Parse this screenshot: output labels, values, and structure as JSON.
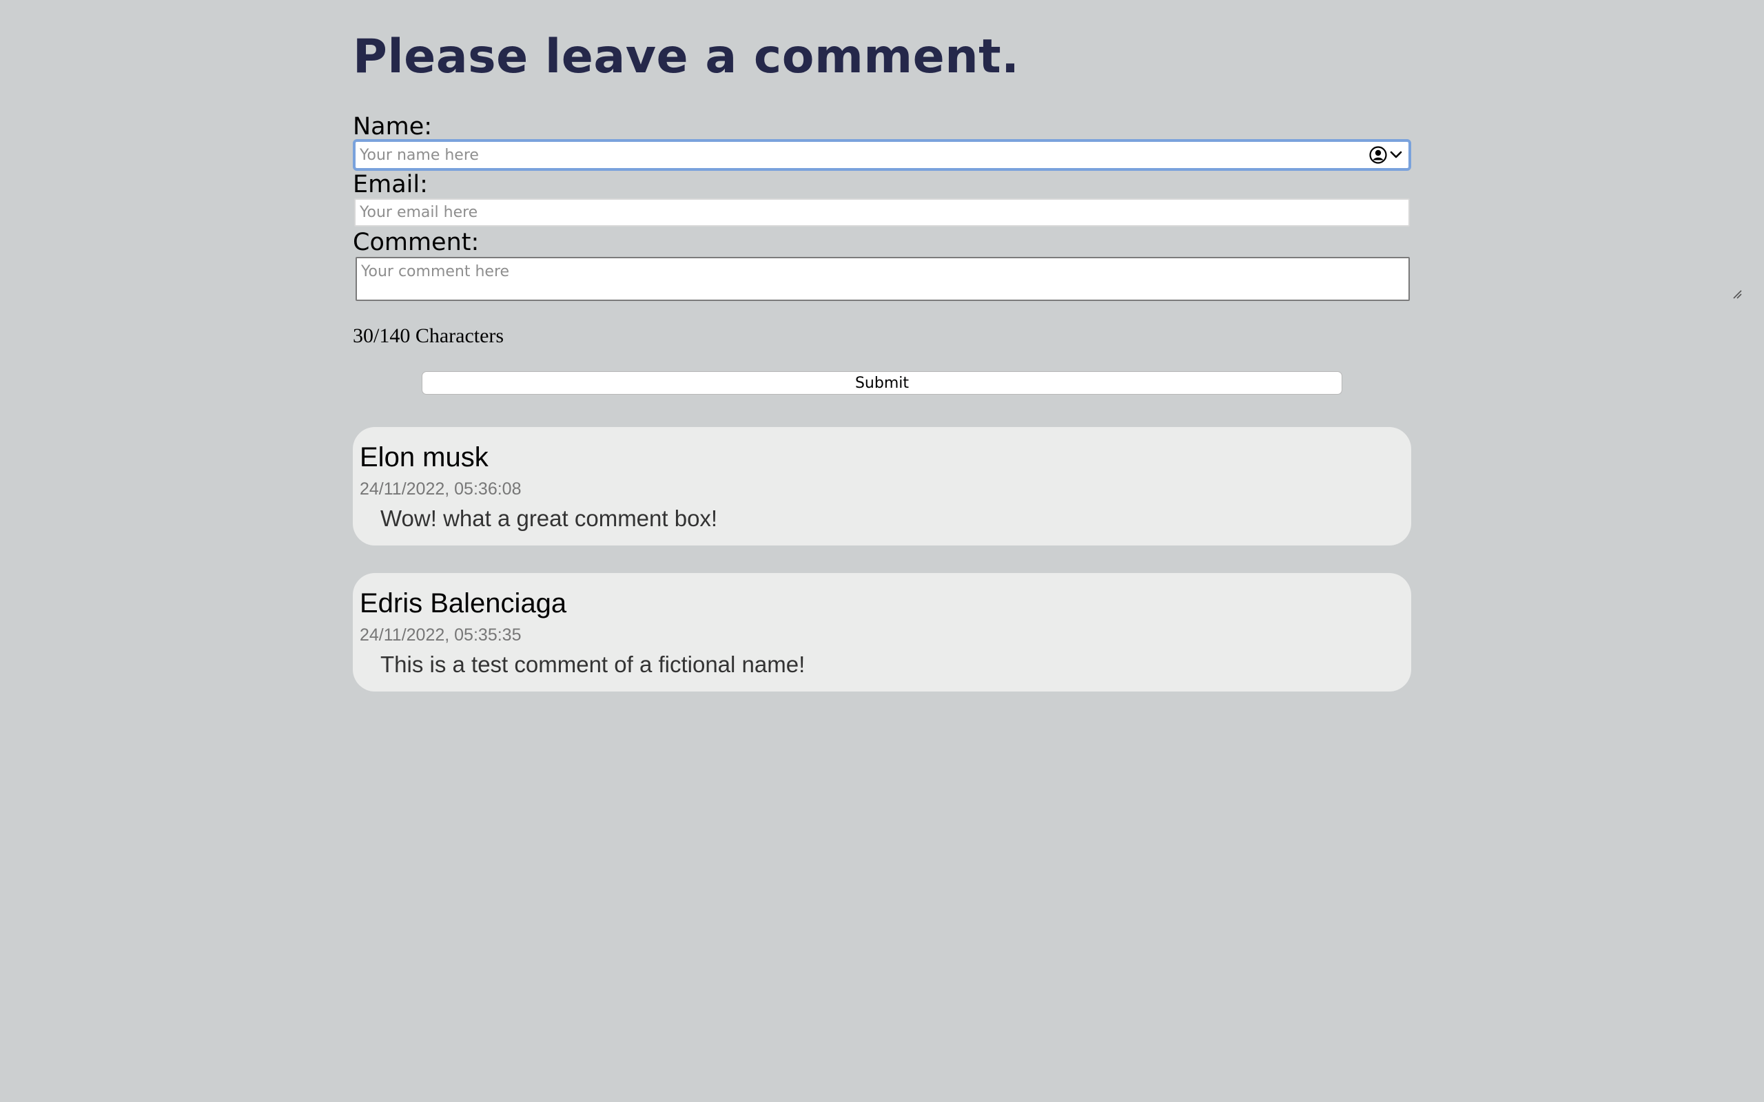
{
  "page": {
    "title": "Please leave a comment."
  },
  "form": {
    "name_label": "Name:",
    "name_placeholder": "Your name here",
    "name_value": "",
    "email_label": "Email:",
    "email_placeholder": "Your email here",
    "email_value": "",
    "comment_label": "Comment:",
    "comment_placeholder": "Your comment here",
    "comment_value": "",
    "char_counter": "30/140 Characters",
    "submit_label": "Submit",
    "autofill_icon": "account-circle-icon",
    "dropdown_icon": "chevron-down-icon"
  },
  "comments": [
    {
      "author": "Elon musk",
      "timestamp": "24/11/2022, 05:36:08",
      "text": "Wow! what a great comment box!"
    },
    {
      "author": "Edris Balenciaga",
      "timestamp": "24/11/2022, 05:35:35",
      "text": "This is a test comment of a fictional name!"
    }
  ],
  "colors": {
    "background": "#cccfd0",
    "title": "#25284a",
    "focus_ring": "#7aa2dc",
    "card_background": "#ebeceb",
    "timestamp": "#777777"
  }
}
